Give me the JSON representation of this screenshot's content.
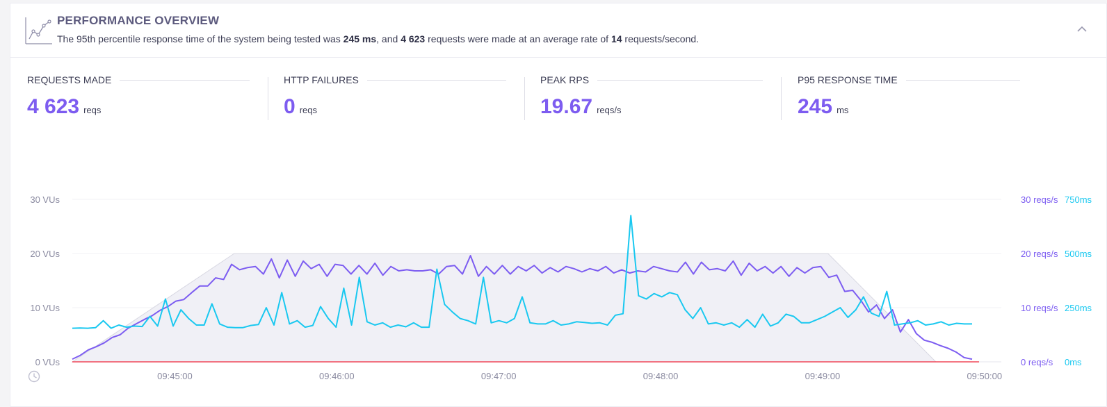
{
  "header": {
    "title": "PERFORMANCE OVERVIEW",
    "desc": {
      "p1": "The 95th percentile response time of the system being tested was ",
      "b1": "245 ms",
      "p2": ", and ",
      "b2": "4 623",
      "p3": " requests were made at an average rate of ",
      "b3": "14",
      "p4": " requests/second."
    },
    "icon": "line-chart-icon",
    "collapse_icon": "chevron-up-icon"
  },
  "stats": [
    {
      "label": "REQUESTS MADE",
      "value": "4 623",
      "unit": "reqs"
    },
    {
      "label": "HTTP FAILURES",
      "value": "0",
      "unit": "reqs"
    },
    {
      "label": "PEAK RPS",
      "value": "19.67",
      "unit": "reqs/s"
    },
    {
      "label": "P95 RESPONSE TIME",
      "value": "245",
      "unit": "ms"
    }
  ],
  "colors": {
    "accent": "#7d5cf0",
    "rps_line": "#7c5cf1",
    "response_line": "#19c8f0",
    "failures_line": "#f0485a",
    "vus_area": "#f0f0f6",
    "text": "#3c3d54"
  },
  "chart_data": {
    "type": "line",
    "x_ticks": [
      "09:45:00",
      "09:46:00",
      "09:47:00",
      "09:48:00",
      "09:49:00",
      "09:50:00"
    ],
    "x_range": [
      "09:44:22",
      "09:49:58"
    ],
    "y_left": {
      "ticks": [
        "0 VUs",
        "10 VUs",
        "20 VUs",
        "30 VUs"
      ],
      "range": [
        0,
        30
      ]
    },
    "y_right_rps": {
      "ticks": [
        "0 reqs/s",
        "10 reqs/s",
        "20 reqs/s",
        "30 reqs/s"
      ],
      "range": [
        0,
        30
      ]
    },
    "y_right_ms": {
      "ticks": [
        "0ms",
        "250ms",
        "500ms",
        "750ms"
      ],
      "range": [
        0,
        750
      ]
    },
    "grid": true,
    "x_time_icon": "clock-icon",
    "series": [
      {
        "axis": "vus",
        "style": "area",
        "points": [
          [
            "09:44:22",
            0
          ],
          [
            "09:45:22",
            20
          ],
          [
            "09:49:02",
            20
          ],
          [
            "09:49:42",
            0
          ]
        ]
      },
      {
        "axis": "rps",
        "style": "line",
        "values": [
          0.5,
          1.2,
          2.2,
          2.8,
          3.5,
          4.5,
          5,
          6.2,
          7,
          7.8,
          8.5,
          9.5,
          10.2,
          11.2,
          11.5,
          12.8,
          14,
          14,
          15.5,
          15.2,
          18,
          17,
          17.4,
          17.6,
          16.2,
          19,
          15.5,
          18.8,
          15.8,
          18.6,
          17.2,
          18,
          15.8,
          18,
          17.8,
          16.2,
          17.8,
          16.2,
          18.2,
          16,
          17.6,
          16.8,
          17,
          16.8,
          16.8,
          17,
          16.2,
          17.6,
          17.8,
          16.2,
          19.6,
          15.8,
          17.6,
          16.2,
          17.8,
          16.2,
          17.6,
          16.8,
          17.8,
          16.4,
          17.4,
          16.6,
          17.6,
          17.2,
          16.6,
          17.2,
          16.8,
          17.6,
          16.4,
          17,
          16.4,
          16.8,
          16.6,
          17.6,
          17.2,
          16.8,
          16.6,
          18.4,
          16.2,
          18.4,
          17,
          17.2,
          16.8,
          18.6,
          16,
          18.2,
          16.8,
          17.6,
          16.4,
          17.6,
          15.8,
          17.4,
          16.4,
          17.4,
          17.6,
          15.6,
          16,
          13,
          13.2,
          11.4,
          9.2,
          10.5,
          8,
          9.6,
          5.5,
          7.8,
          5.2,
          4,
          3.6,
          3,
          2.5,
          1.8,
          0.8,
          0.5
        ]
      },
      {
        "axis": "ms",
        "style": "line",
        "values": [
          155,
          156,
          155,
          158,
          190,
          155,
          170,
          160,
          165,
          163,
          210,
          165,
          290,
          165,
          240,
          200,
          170,
          170,
          268,
          175,
          160,
          158,
          158,
          168,
          172,
          250,
          170,
          320,
          175,
          190,
          160,
          168,
          255,
          200,
          160,
          340,
          170,
          390,
          185,
          170,
          180,
          160,
          170,
          162,
          180,
          160,
          160,
          428,
          265,
          230,
          200,
          190,
          175,
          390,
          180,
          190,
          180,
          200,
          300,
          180,
          175,
          175,
          190,
          170,
          175,
          185,
          182,
          178,
          180,
          170,
          215,
          222,
          675,
          305,
          290,
          315,
          300,
          320,
          310,
          240,
          200,
          250,
          175,
          180,
          170,
          180,
          160,
          195,
          160,
          220,
          165,
          180,
          220,
          210,
          180,
          180,
          195,
          210,
          230,
          250,
          205,
          240,
          300,
          225,
          210,
          325,
          170,
          175,
          180,
          190,
          170,
          175,
          185,
          170,
          178,
          175,
          175
        ]
      },
      {
        "axis": "rps",
        "style": "line",
        "name_hint": "failures",
        "values": [
          0,
          0
        ]
      }
    ]
  }
}
